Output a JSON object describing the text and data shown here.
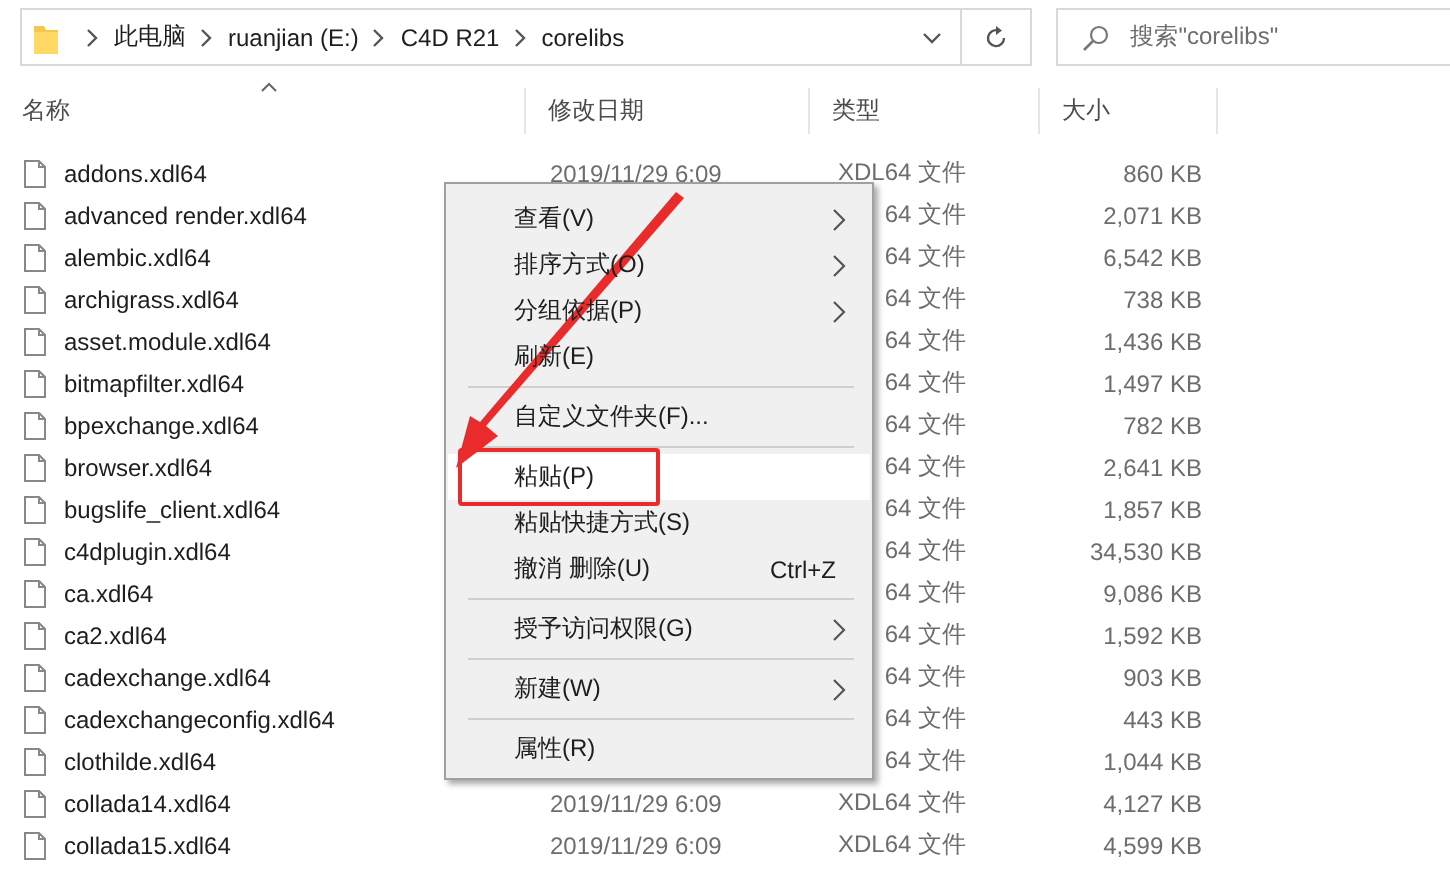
{
  "address_bar": {
    "breadcrumbs": [
      "此电脑",
      "ruanjian (E:)",
      "C4D R21",
      "corelibs"
    ]
  },
  "search": {
    "placeholder": "搜索\"corelibs\""
  },
  "table": {
    "columns": [
      {
        "label": "名称",
        "sorted": true
      },
      {
        "label": "修改日期",
        "sorted": false
      },
      {
        "label": "类型",
        "sorted": false
      },
      {
        "label": "大小",
        "sorted": false
      }
    ],
    "rows": [
      {
        "name": "addons.xdl64",
        "date": "2019/11/29 6:09",
        "type": "XDL64 文件",
        "size": "860 KB"
      },
      {
        "name": "advanced render.xdl64",
        "type": "64 文件",
        "size": "2,071 KB"
      },
      {
        "name": "alembic.xdl64",
        "type": "64 文件",
        "size": "6,542 KB"
      },
      {
        "name": "archigrass.xdl64",
        "type": "64 文件",
        "size": "738 KB"
      },
      {
        "name": "asset.module.xdl64",
        "type": "64 文件",
        "size": "1,436 KB"
      },
      {
        "name": "bitmapfilter.xdl64",
        "type": "64 文件",
        "size": "1,497 KB"
      },
      {
        "name": "bpexchange.xdl64",
        "type": "64 文件",
        "size": "782 KB"
      },
      {
        "name": "browser.xdl64",
        "type": "64 文件",
        "size": "2,641 KB"
      },
      {
        "name": "bugslife_client.xdl64",
        "type": "64 文件",
        "size": "1,857 KB"
      },
      {
        "name": "c4dplugin.xdl64",
        "type": "64 文件",
        "size": "34,530 KB"
      },
      {
        "name": "ca.xdl64",
        "type": "64 文件",
        "size": "9,086 KB"
      },
      {
        "name": "ca2.xdl64",
        "type": "64 文件",
        "size": "1,592 KB"
      },
      {
        "name": "cadexchange.xdl64",
        "type": "64 文件",
        "size": "903 KB"
      },
      {
        "name": "cadexchangeconfig.xdl64",
        "type": "64 文件",
        "size": "443 KB"
      },
      {
        "name": "clothilde.xdl64",
        "type": "64 文件",
        "size": "1,044 KB"
      },
      {
        "name": "collada14.xdl64",
        "date": "2019/11/29 6:09",
        "type": "XDL64 文件",
        "size": "4,127 KB"
      },
      {
        "name": "collada15.xdl64",
        "date": "2019/11/29 6:09",
        "type": "XDL64 文件",
        "size": "4,599 KB"
      }
    ]
  },
  "context_menu": {
    "items": [
      {
        "kind": "item",
        "label": "查看(V)",
        "submenu": true,
        "selected": false
      },
      {
        "kind": "item",
        "label": "排序方式(O)",
        "submenu": true,
        "selected": false
      },
      {
        "kind": "item",
        "label": "分组依据(P)",
        "submenu": true,
        "selected": false
      },
      {
        "kind": "item",
        "label": "刷新(E)",
        "submenu": false,
        "selected": false
      },
      {
        "kind": "separator"
      },
      {
        "kind": "item",
        "label": "自定义文件夹(F)...",
        "submenu": false,
        "selected": false
      },
      {
        "kind": "separator"
      },
      {
        "kind": "item",
        "label": "粘贴(P)",
        "submenu": false,
        "selected": true
      },
      {
        "kind": "item",
        "label": "粘贴快捷方式(S)",
        "submenu": false,
        "selected": false
      },
      {
        "kind": "item",
        "label": "撤消 删除(U)",
        "shortcut": "Ctrl+Z",
        "submenu": false,
        "selected": false
      },
      {
        "kind": "separator"
      },
      {
        "kind": "item",
        "label": "授予访问权限(G)",
        "submenu": true,
        "selected": false
      },
      {
        "kind": "separator"
      },
      {
        "kind": "item",
        "label": "新建(W)",
        "submenu": true,
        "selected": false
      },
      {
        "kind": "separator"
      },
      {
        "kind": "item",
        "label": "属性(R)",
        "submenu": false,
        "selected": false
      }
    ]
  },
  "annotations": {
    "arrow": true,
    "highlight_frame": true
  }
}
